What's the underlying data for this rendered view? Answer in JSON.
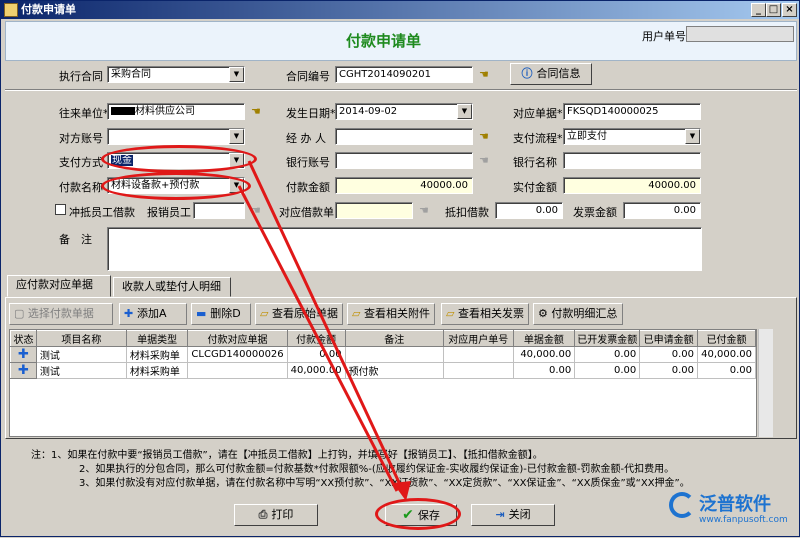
{
  "window": {
    "title": "付款申请单"
  },
  "header": {
    "page_title": "付款申请单",
    "user_no_label": "用户单号",
    "user_no_value": ""
  },
  "contract": {
    "exec_label": "执行合同",
    "exec_value": "采购合同",
    "no_label": "合同编号",
    "no_value": "CGHT2014090201",
    "info_button": "合同信息"
  },
  "form": {
    "partner_label": "往来单位*",
    "partner_value": "材料供应公司",
    "date_label": "发生日期*",
    "date_value": "2014-09-02",
    "ref_label": "对应单据*",
    "ref_value": "FKSQD140000025",
    "account_label": "对方账号",
    "account_value": "",
    "handler_label": "经 办 人",
    "handler_value": "",
    "flow_label": "支付流程*",
    "flow_value": "立即支付",
    "paymethod_label": "支付方式",
    "paymethod_value": "现金",
    "bank_acct_label": "银行账号",
    "bank_acct_value": "",
    "bank_name_label": "银行名称",
    "bank_name_value": "",
    "payname_label": "付款名称",
    "payname_value": "材料设备款+预付款",
    "payamt_label": "付款金额",
    "payamt_value": "40000.00",
    "actual_label": "实付金额",
    "actual_value": "40000.00",
    "offset_label": "冲抵员工借款",
    "employee_label": "报销员工",
    "employee_value": "",
    "loan_doc_label": "对应借款单",
    "loan_doc_value": "",
    "loan_offset_label": "抵扣借款",
    "loan_offset_value": "0.00",
    "invoice_label": "发票金额",
    "invoice_value": "0.00",
    "remark_label": "备　注",
    "remark_value": ""
  },
  "tabs": [
    {
      "label": "应付款对应单据"
    },
    {
      "label": "收款人或垫付人明细"
    }
  ],
  "toolbar": {
    "select": "选择付款单据",
    "add": "添加A",
    "delete": "删除D",
    "view_origin": "查看原始单据",
    "view_attach": "查看相关附件",
    "view_invoice": "查看相关发票",
    "summary": "付款明细汇总"
  },
  "grid": {
    "columns": [
      "状态",
      "项目名称",
      "单据类型",
      "付款对应单据",
      "付款金额",
      "备注",
      "对应用户单号",
      "单据金额",
      "已开发票金额",
      "已申请金额",
      "已付金额"
    ],
    "rows": [
      [
        "✚",
        "测试",
        "材料采购单",
        "CLCGD140000026",
        "0.00",
        "",
        "",
        "40,000.00",
        "0.00",
        "0.00",
        "40,000.00"
      ],
      [
        "✚",
        "测试",
        "材料采购单",
        "",
        "40,000.00",
        "预付款",
        "",
        "0.00",
        "0.00",
        "0.00",
        "0.00"
      ]
    ]
  },
  "notes": [
    "注：1、如果在付款中要“报销员工借款”，请在【冲抵员工借款】上打钩，并填写好【报销员工】、【抵扣借款金额】。",
    "2、如果执行的分包合同，那么可付款金额=付款基数*付款限额%-(应收履约保证金-实收履约保证金)-已付款金额-罚款金额-代扣费用。",
    "3、如果付款没有对应付款单据，请在付款名称中写明“XX预付款”、“XX订货款”、“XX定货款”、“XX保证金”、“XX质保金”或“XX押金”。"
  ],
  "buttons": {
    "print": "打印",
    "save": "保存",
    "close": "关闭"
  },
  "logo": {
    "name": "泛普软件",
    "url": "www.fanpusoft.com"
  }
}
